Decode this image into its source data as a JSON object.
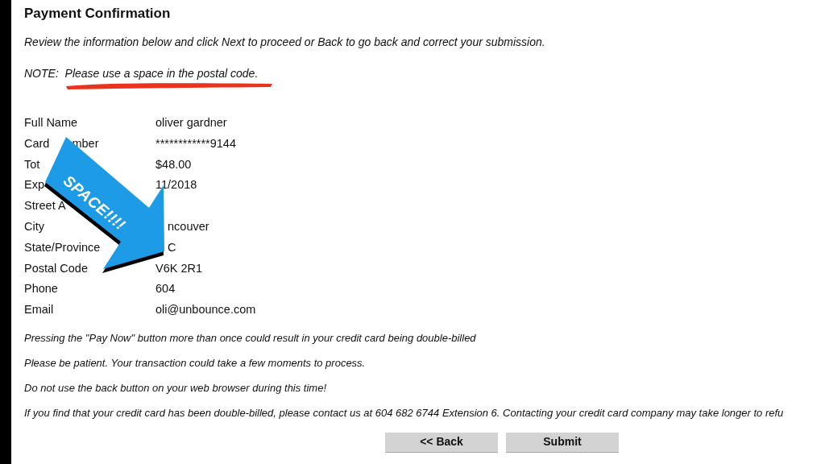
{
  "title": "Payment Confirmation",
  "intro": "Review the information below and click Next to proceed or Back to go back and correct your submission.",
  "note": "NOTE:  Please use a space in the postal code.",
  "rows": [
    {
      "kind": "full",
      "label": "Full Name",
      "value": "oliver gardner"
    },
    {
      "kind": "label_split",
      "label": "Card",
      "label_tail": "mber",
      "value": "************9144"
    },
    {
      "kind": "label_cut",
      "label": "Tot",
      "value": "$48.00"
    },
    {
      "kind": "label_cut",
      "label": "Exp",
      "value": "11/2018"
    },
    {
      "kind": "label_cut",
      "label": "Street A"
    },
    {
      "kind": "value_cut",
      "label": "City",
      "value": "ncouver"
    },
    {
      "kind": "value_cut",
      "label": "State/Province",
      "value": "C"
    },
    {
      "kind": "full",
      "label": "Postal Code",
      "value": "V6K 2R1"
    },
    {
      "kind": "full",
      "label": "Phone",
      "value": "604"
    },
    {
      "kind": "full",
      "label": "Email",
      "value": "oli@unbounce.com"
    }
  ],
  "notices": [
    "Pressing the \"Pay Now\" button more than once could result in your credit card being double-billed",
    "Please be patient. Your transaction could take a few moments to process.",
    "Do not use the back button on your web browser during this time!",
    "If you find that your credit card has been double-billed, please contact us at 604 682 6744 Extension 6. Contacting your credit card company may take longer to refu"
  ],
  "buttons": [
    "<< Back",
    "Submit"
  ],
  "annotation": {
    "text": "SPACE!!!!"
  }
}
